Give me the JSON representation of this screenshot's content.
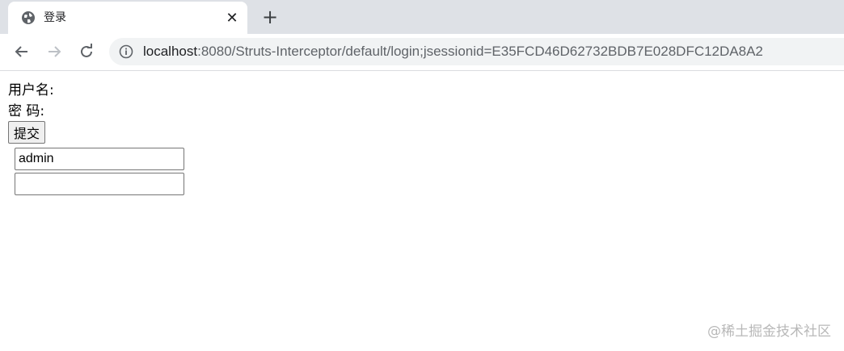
{
  "browser": {
    "tab_title": "登录",
    "tab_close": "✕",
    "new_tab": "+",
    "url_host": "localhost",
    "url_rest": ":8080/Struts-Interceptor/default/login;jsessionid=E35FCD46D62732BDB7E028DFC12DA8A2"
  },
  "form": {
    "username_label": "用户名:",
    "password_label": "密 码:",
    "submit_label": "提交",
    "username_value": "admin",
    "password_value": ""
  },
  "watermark": "@稀土掘金技术社区"
}
